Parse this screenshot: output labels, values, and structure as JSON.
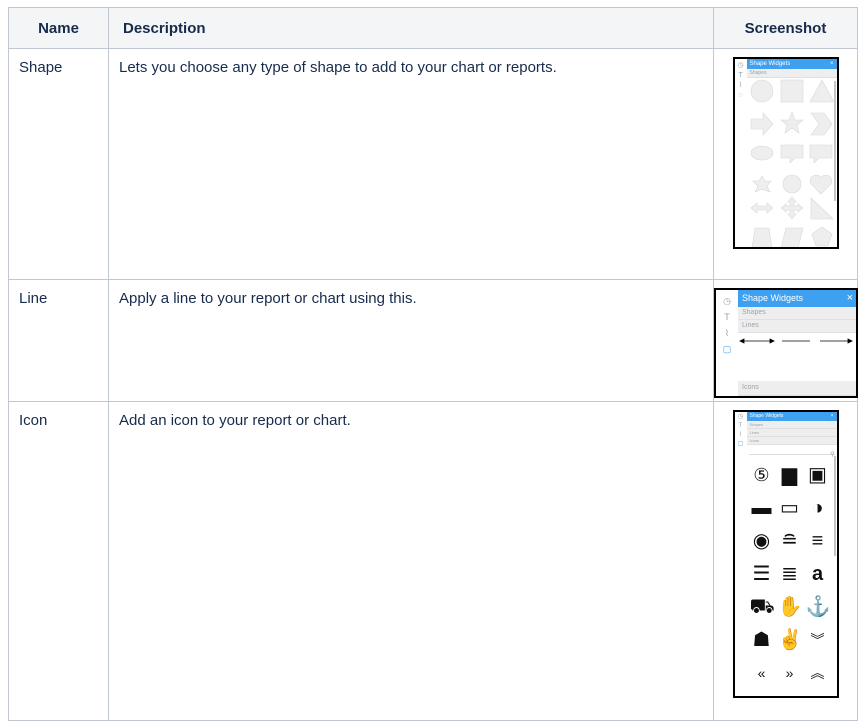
{
  "table": {
    "headers": {
      "name": "Name",
      "description": "Description",
      "screenshot": "Screenshot"
    },
    "rows": [
      {
        "name": "Shape",
        "description": "Lets you choose any type of shape to add to your chart or reports."
      },
      {
        "name": "Line",
        "description": "Apply a line to your report or chart using this."
      },
      {
        "name": "Icon",
        "description": "Add an icon to your report or chart."
      }
    ]
  },
  "shape_widget": {
    "title": "Shape Widgets",
    "section": "Shapes",
    "close": "×",
    "rail_icons": [
      "clock-icon",
      "text-icon",
      "chart-icon",
      "shape-icon"
    ]
  },
  "line_widget": {
    "title": "Shape Widgets",
    "sections": [
      "Shapes",
      "Lines",
      "Icons"
    ],
    "close": "×"
  },
  "icon_widget": {
    "title": "Shape Widgets",
    "sections": [
      "Shapes",
      "Lines",
      "Icons"
    ],
    "close": "×",
    "icon_names": [
      "500px-icon",
      "address-book-icon",
      "address-book-o-icon",
      "address-card-icon",
      "address-card-o-icon",
      "adjust-icon",
      "adn-icon",
      "align-center-icon",
      "align-justify-icon",
      "align-left-icon",
      "align-right-icon",
      "amazon-icon",
      "ambulance-icon",
      "american-sign-language-icon",
      "anchor-icon",
      "android-icon",
      "angellist-icon",
      "angle-double-down-icon"
    ]
  },
  "colors": {
    "accent": "#3ea0f0",
    "header_bg": "#f4f5f7",
    "border": "#c1c7d0"
  }
}
